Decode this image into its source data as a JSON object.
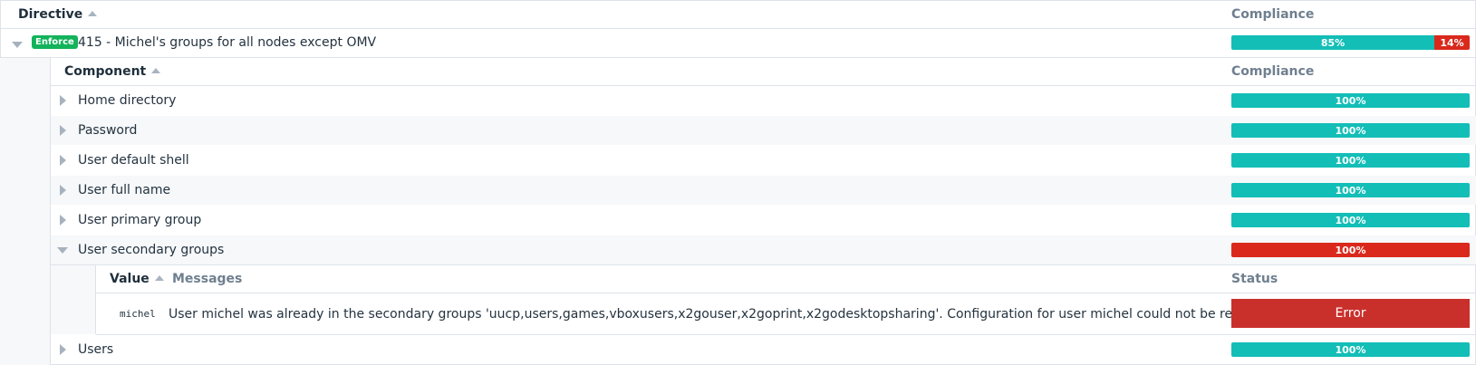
{
  "directive_table": {
    "header": {
      "directive": "Directive",
      "compliance": "Compliance"
    },
    "directive": {
      "badge": "Enforce",
      "name": "415 - Michel's groups for all nodes except OMV",
      "compliance": {
        "success_label": "85%",
        "error_label": "14%",
        "success": 0.85,
        "error": 0.14
      }
    }
  },
  "component_table": {
    "header": {
      "component": "Component",
      "compliance": "Compliance"
    },
    "rows": [
      {
        "label": "Home directory",
        "compliance_label": "100%",
        "status": "success"
      },
      {
        "label": "Password",
        "compliance_label": "100%",
        "status": "success"
      },
      {
        "label": "User default shell",
        "compliance_label": "100%",
        "status": "success"
      },
      {
        "label": "User full name",
        "compliance_label": "100%",
        "status": "success"
      },
      {
        "label": "User primary group",
        "compliance_label": "100%",
        "status": "success"
      },
      {
        "label": "User secondary groups",
        "compliance_label": "100%",
        "status": "error"
      },
      {
        "label": "Users",
        "compliance_label": "100%",
        "status": "success"
      }
    ]
  },
  "value_table": {
    "header": {
      "value": "Value",
      "messages": "Messages",
      "status": "Status"
    },
    "row": {
      "value": "michel",
      "message": "User michel was already in the secondary groups 'uucp,users,games,vboxusers,x2gouser,x2goprint,x2godesktopsharing'. Configuration for user michel could not be repaired",
      "status": "Error"
    }
  },
  "colors": {
    "success": "#13beb7",
    "error": "#da291c",
    "enforce_badge": "#13b35b",
    "error_status": "#c9302c"
  }
}
